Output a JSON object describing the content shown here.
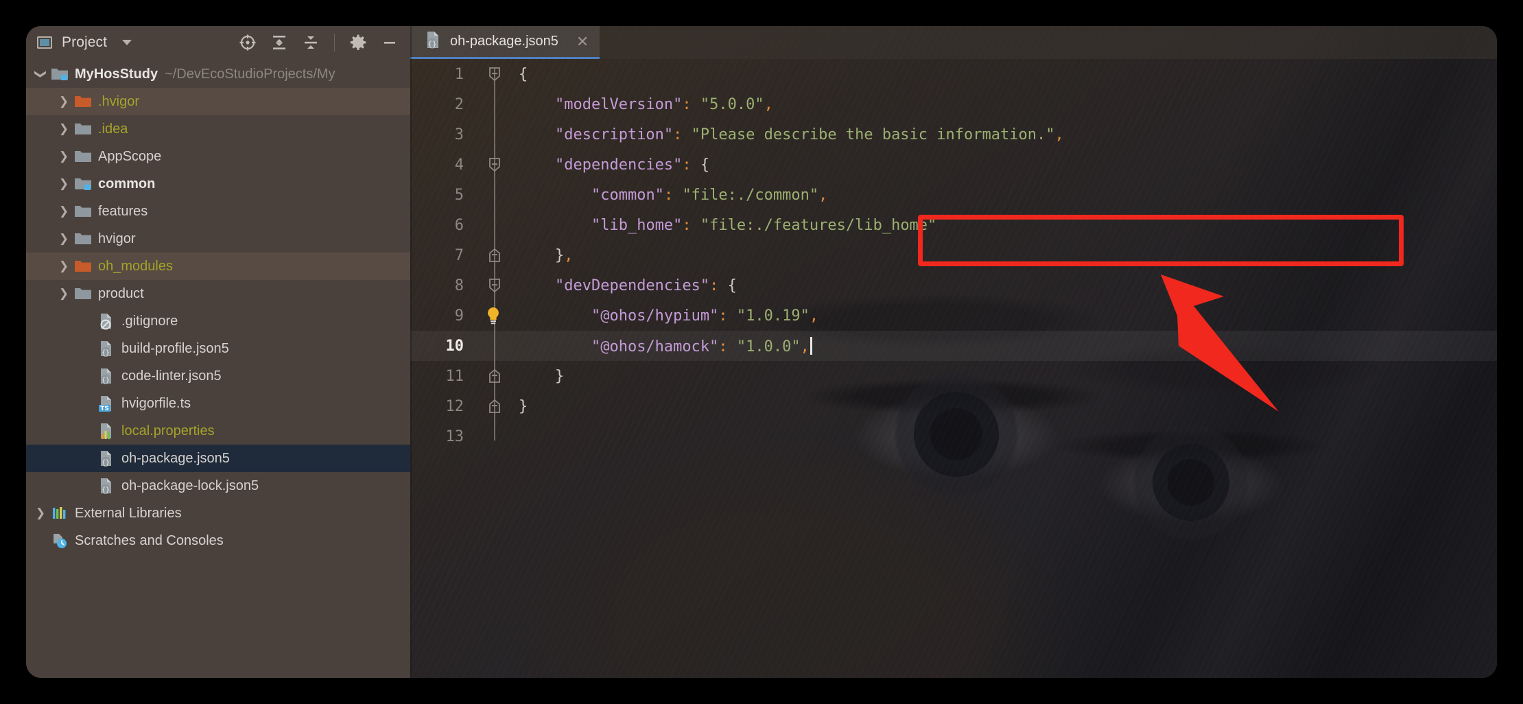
{
  "window": {
    "background_color": "#000000",
    "chrome_color": "#4a413c"
  },
  "sidebar": {
    "header": {
      "tool_window_label": "Project",
      "dropdown_icon": "chevron-down-icon",
      "window_icon": "project-tool-window-icon",
      "actions": [
        {
          "name": "select-opened-file-icon",
          "title": "Select Opened File"
        },
        {
          "name": "expand-all-icon",
          "title": "Expand All"
        },
        {
          "name": "collapse-all-icon",
          "title": "Collapse All"
        },
        {
          "name": "settings-gear-icon",
          "title": "Options"
        },
        {
          "name": "hide-panel-icon",
          "title": "Hide"
        }
      ]
    },
    "tree": [
      {
        "label": "MyHosStudy",
        "path_hint": "~/DevEcoStudioProjects/My",
        "depth": 0,
        "arrow": "expanded",
        "icon": "project-root-folder-icon",
        "style": "bold",
        "state": "normal"
      },
      {
        "label": ".hvigor",
        "path_hint": "",
        "depth": 1,
        "arrow": "collapsed",
        "icon": "excluded-folder-icon",
        "style": "excluded",
        "state": "highlight"
      },
      {
        "label": ".idea",
        "path_hint": "",
        "depth": 1,
        "arrow": "collapsed",
        "icon": "folder-icon",
        "style": "excluded",
        "state": "normal"
      },
      {
        "label": "AppScope",
        "path_hint": "",
        "depth": 1,
        "arrow": "collapsed",
        "icon": "folder-icon",
        "style": "normal",
        "state": "normal"
      },
      {
        "label": "common",
        "path_hint": "",
        "depth": 1,
        "arrow": "collapsed",
        "icon": "module-folder-icon",
        "style": "bold",
        "state": "normal"
      },
      {
        "label": "features",
        "path_hint": "",
        "depth": 1,
        "arrow": "collapsed",
        "icon": "folder-icon",
        "style": "normal",
        "state": "normal"
      },
      {
        "label": "hvigor",
        "path_hint": "",
        "depth": 1,
        "arrow": "collapsed",
        "icon": "folder-icon",
        "style": "normal",
        "state": "normal"
      },
      {
        "label": "oh_modules",
        "path_hint": "",
        "depth": 1,
        "arrow": "collapsed",
        "icon": "excluded-folder-icon",
        "style": "excluded",
        "state": "highlight"
      },
      {
        "label": "product",
        "path_hint": "",
        "depth": 1,
        "arrow": "collapsed",
        "icon": "folder-icon",
        "style": "normal",
        "state": "normal"
      },
      {
        "label": ".gitignore",
        "path_hint": "",
        "depth": 2,
        "arrow": "none",
        "icon": "gitignore-file-icon",
        "style": "normal",
        "state": "normal"
      },
      {
        "label": "build-profile.json5",
        "path_hint": "",
        "depth": 2,
        "arrow": "none",
        "icon": "json5-file-icon",
        "style": "normal",
        "state": "normal"
      },
      {
        "label": "code-linter.json5",
        "path_hint": "",
        "depth": 2,
        "arrow": "none",
        "icon": "json5-file-icon",
        "style": "normal",
        "state": "normal"
      },
      {
        "label": "hvigorfile.ts",
        "path_hint": "",
        "depth": 2,
        "arrow": "none",
        "icon": "typescript-file-icon",
        "style": "normal",
        "state": "normal"
      },
      {
        "label": "local.properties",
        "path_hint": "",
        "depth": 2,
        "arrow": "none",
        "icon": "properties-file-icon",
        "style": "excluded",
        "state": "normal"
      },
      {
        "label": "oh-package.json5",
        "path_hint": "",
        "depth": 2,
        "arrow": "none",
        "icon": "json5-file-icon",
        "style": "normal",
        "state": "selected"
      },
      {
        "label": "oh-package-lock.json5",
        "path_hint": "",
        "depth": 2,
        "arrow": "none",
        "icon": "json5-file-icon",
        "style": "normal",
        "state": "normal"
      },
      {
        "label": "External Libraries",
        "path_hint": "",
        "depth": 0,
        "arrow": "collapsed",
        "icon": "external-libraries-icon",
        "style": "normal",
        "state": "normal"
      },
      {
        "label": "Scratches and Consoles",
        "path_hint": "",
        "depth": 0,
        "arrow": "none",
        "icon": "scratches-icon",
        "style": "normal",
        "state": "normal"
      }
    ]
  },
  "editor": {
    "tab": {
      "title": "oh-package.json5",
      "icon": "json5-file-icon",
      "close_icon": "close-icon",
      "active": true
    },
    "current_line": 10,
    "lines": [
      {
        "number": "1",
        "fold": "open-top",
        "bulb": false,
        "indent": 0,
        "tokens": [
          {
            "t": "{",
            "c": "p"
          }
        ]
      },
      {
        "number": "2",
        "fold": "none",
        "bulb": false,
        "indent": 1,
        "tokens": [
          {
            "t": "\"modelVersion\"",
            "c": "k"
          },
          {
            "t": ":",
            "c": "c"
          },
          {
            "t": " ",
            "c": "p"
          },
          {
            "t": "\"5.0.0\"",
            "c": "s"
          },
          {
            "t": ",",
            "c": "c"
          }
        ]
      },
      {
        "number": "3",
        "fold": "none",
        "bulb": false,
        "indent": 1,
        "tokens": [
          {
            "t": "\"description\"",
            "c": "k"
          },
          {
            "t": ":",
            "c": "c"
          },
          {
            "t": " ",
            "c": "p"
          },
          {
            "t": "\"Please describe the basic information.\"",
            "c": "s"
          },
          {
            "t": ",",
            "c": "c"
          }
        ]
      },
      {
        "number": "4",
        "fold": "open-top",
        "bulb": false,
        "indent": 1,
        "tokens": [
          {
            "t": "\"dependencies\"",
            "c": "k"
          },
          {
            "t": ":",
            "c": "c"
          },
          {
            "t": " ",
            "c": "p"
          },
          {
            "t": "{",
            "c": "p"
          }
        ]
      },
      {
        "number": "5",
        "fold": "none",
        "bulb": false,
        "indent": 2,
        "tokens": [
          {
            "t": "\"common\"",
            "c": "k"
          },
          {
            "t": ":",
            "c": "c"
          },
          {
            "t": " ",
            "c": "p"
          },
          {
            "t": "\"file:./common\"",
            "c": "s"
          },
          {
            "t": ",",
            "c": "c"
          }
        ]
      },
      {
        "number": "6",
        "fold": "none",
        "bulb": false,
        "indent": 2,
        "tokens": [
          {
            "t": "\"lib_home\"",
            "c": "k"
          },
          {
            "t": ":",
            "c": "c"
          },
          {
            "t": " ",
            "c": "p"
          },
          {
            "t": "\"file:./features/lib_home\"",
            "c": "s"
          }
        ]
      },
      {
        "number": "7",
        "fold": "open-bottom",
        "bulb": false,
        "indent": 1,
        "tokens": [
          {
            "t": "}",
            "c": "p"
          },
          {
            "t": ",",
            "c": "c"
          }
        ]
      },
      {
        "number": "8",
        "fold": "open-top",
        "bulb": false,
        "indent": 1,
        "tokens": [
          {
            "t": "\"devDependencies\"",
            "c": "k"
          },
          {
            "t": ":",
            "c": "c"
          },
          {
            "t": " ",
            "c": "p"
          },
          {
            "t": "{",
            "c": "p"
          }
        ]
      },
      {
        "number": "9",
        "fold": "none",
        "bulb": true,
        "indent": 2,
        "tokens": [
          {
            "t": "\"@ohos/hypium\"",
            "c": "k"
          },
          {
            "t": ":",
            "c": "c"
          },
          {
            "t": " ",
            "c": "p"
          },
          {
            "t": "\"1.0.19\"",
            "c": "s"
          },
          {
            "t": ",",
            "c": "c"
          }
        ]
      },
      {
        "number": "10",
        "fold": "none",
        "bulb": false,
        "indent": 2,
        "caret_after": true,
        "tokens": [
          {
            "t": "\"@ohos/hamock\"",
            "c": "k"
          },
          {
            "t": ":",
            "c": "c"
          },
          {
            "t": " ",
            "c": "p"
          },
          {
            "t": "\"1.0.0\"",
            "c": "s"
          },
          {
            "t": ",",
            "c": "c"
          }
        ]
      },
      {
        "number": "11",
        "fold": "open-bottom",
        "bulb": false,
        "indent": 1,
        "tokens": [
          {
            "t": "}",
            "c": "p"
          }
        ]
      },
      {
        "number": "12",
        "fold": "open-bottom",
        "bulb": false,
        "indent": 0,
        "tokens": [
          {
            "t": "}",
            "c": "p"
          }
        ]
      },
      {
        "number": "13",
        "fold": "none",
        "bulb": false,
        "indent": 0,
        "tokens": []
      }
    ],
    "syntax_colors": {
      "key": "#c49bd6",
      "punctuation": "#e08d3c",
      "string": "#9cb071",
      "brace": "#cfcac6",
      "line_number": "#8d8783"
    }
  },
  "annotations": {
    "highlight_box": {
      "name": "red-highlight-box",
      "color": "#f0281e",
      "covers_lines": [
        5,
        6
      ]
    },
    "arrow": {
      "name": "red-pointer-arrow",
      "color": "#f0281e",
      "points_to": "red-highlight-box"
    }
  }
}
